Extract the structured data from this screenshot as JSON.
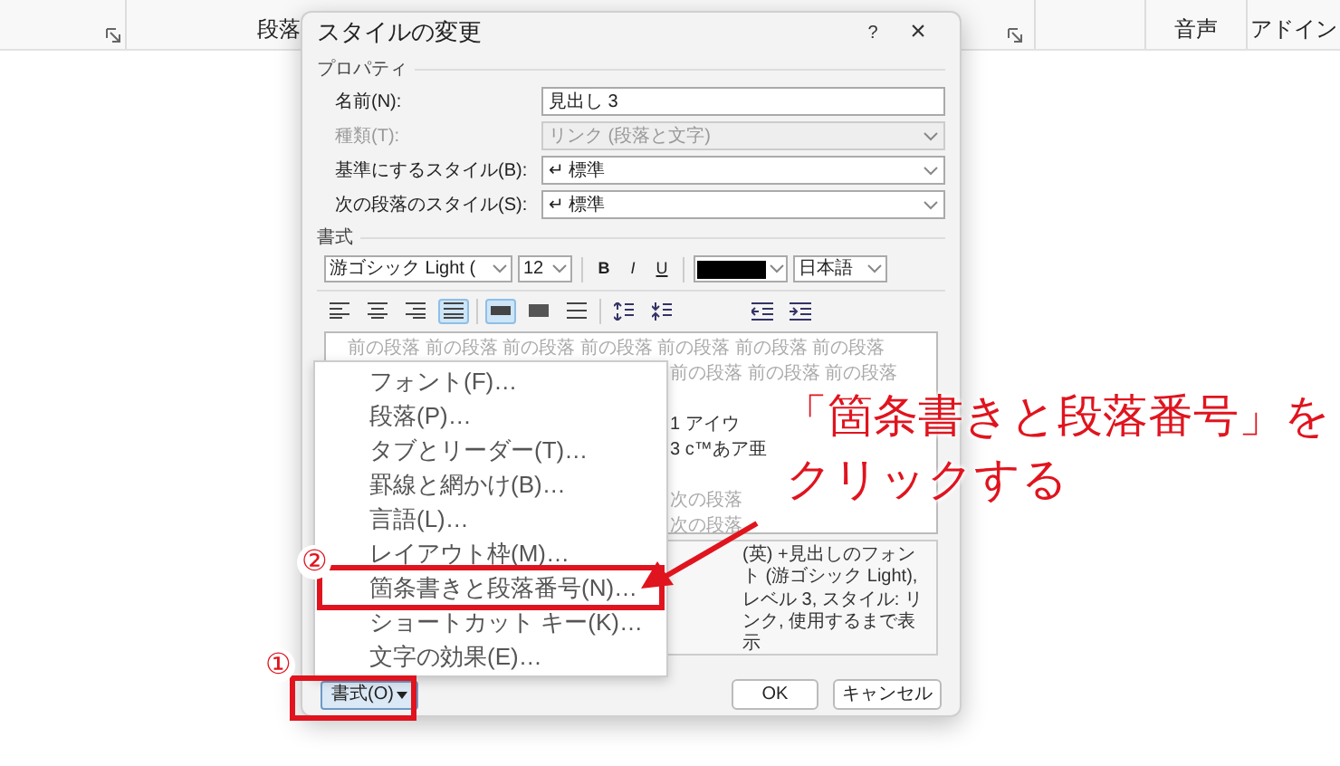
{
  "ribbon": {
    "groups": [
      "段落",
      "音声",
      "アドイン"
    ]
  },
  "dialog": {
    "title": "スタイルの変更",
    "help": "?",
    "close": "×",
    "properties": {
      "heading": "プロパティ",
      "rows": [
        {
          "label": "名前(N):",
          "value": "見出し 3",
          "kind": "text",
          "disabled": false
        },
        {
          "label": "種類(T):",
          "value": "リンク (段落と文字)",
          "kind": "select",
          "disabled": true
        },
        {
          "label": "基準にするスタイル(B):",
          "value": "↵ 標準",
          "kind": "select",
          "disabled": false
        },
        {
          "label": "次の段落のスタイル(S):",
          "value": "↵ 標準",
          "kind": "select",
          "disabled": false
        }
      ]
    },
    "format": {
      "heading": "書式",
      "font": "游ゴシック Light (",
      "size": "12",
      "bold": "B",
      "italic": "I",
      "underline": "U",
      "language": "日本語"
    },
    "toolbar": [
      {
        "kind": "left",
        "selected": false
      },
      {
        "kind": "center",
        "selected": false
      },
      {
        "kind": "right",
        "selected": false
      },
      {
        "kind": "justify",
        "selected": true
      },
      {
        "kind": "sep"
      },
      {
        "kind": "single",
        "selected": true
      },
      {
        "kind": "onehalf",
        "selected": false
      },
      {
        "kind": "double",
        "selected": false
      },
      {
        "kind": "sep"
      },
      {
        "kind": "spaceup",
        "selected": false
      },
      {
        "kind": "spacedown",
        "selected": false
      },
      {
        "kind": "gap"
      },
      {
        "kind": "outdent",
        "selected": false
      },
      {
        "kind": "indent",
        "selected": false
      }
    ],
    "preview": [
      {
        "text": "前の段落 前の段落 前の段落 前の段落 前の段落 前の段落 前の段落",
        "kind": "full"
      },
      {
        "text": "前の段落 前の段落 前の段落",
        "kind": "clipped"
      },
      {
        "text": "1 アイウ",
        "kind": "sample"
      },
      {
        "text": "3 c™あア亜",
        "kind": "sample"
      },
      {
        "text": "次の段落",
        "kind": "clipped"
      },
      {
        "text": "次の段落",
        "kind": "clipped"
      }
    ],
    "description": [
      "(英) +見出しのフォント (游ゴシック Light),",
      "レベル 3, スタイル: リンク, 使用するまで表示"
    ],
    "format_button": "書式(O)",
    "ok": "OK",
    "cancel": "キャンセル"
  },
  "menu": [
    {
      "label": "フォント(F)…",
      "highlighted": false
    },
    {
      "label": "段落(P)…",
      "highlighted": false
    },
    {
      "label": "タブとリーダー(T)…",
      "highlighted": false
    },
    {
      "label": "罫線と網かけ(B)…",
      "highlighted": false
    },
    {
      "label": "言語(L)…",
      "highlighted": false
    },
    {
      "label": "レイアウト枠(M)…",
      "highlighted": false
    },
    {
      "label": "箇条書きと段落番号(N)…",
      "highlighted": true
    },
    {
      "label": "ショートカット キー(K)…",
      "highlighted": false
    },
    {
      "label": "文字の効果(E)…",
      "highlighted": false
    }
  ],
  "annotation": {
    "steps": [
      "①",
      "②"
    ],
    "callout": [
      "「箇条書きと段落番号」を",
      "クリックする"
    ]
  }
}
